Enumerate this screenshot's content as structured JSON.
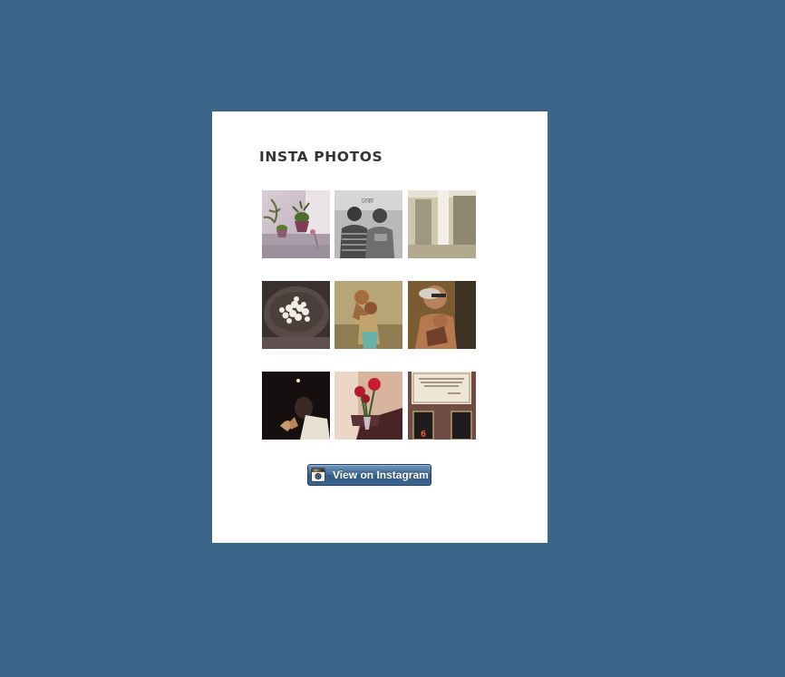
{
  "widget": {
    "title": "INSTA PHOTOS",
    "photos": [
      {
        "name": "potted-plants-photo"
      },
      {
        "name": "two-men-portrait-photo"
      },
      {
        "name": "empty-room-pillar-photo"
      },
      {
        "name": "popcorn-bowl-photo"
      },
      {
        "name": "child-on-shoulder-photo"
      },
      {
        "name": "elderly-man-and-child-photo"
      },
      {
        "name": "praying-hands-dark-photo"
      },
      {
        "name": "red-roses-vase-photo"
      },
      {
        "name": "elevator-sign-photo"
      }
    ],
    "elevator_digit": "6",
    "button": {
      "label": "View on Instagram",
      "icon": "instagram-camera-icon"
    }
  },
  "colors": {
    "page_background": "#3b6589",
    "card_background": "#ffffff",
    "title_color": "#333333",
    "button_blue": "#3e6892"
  }
}
